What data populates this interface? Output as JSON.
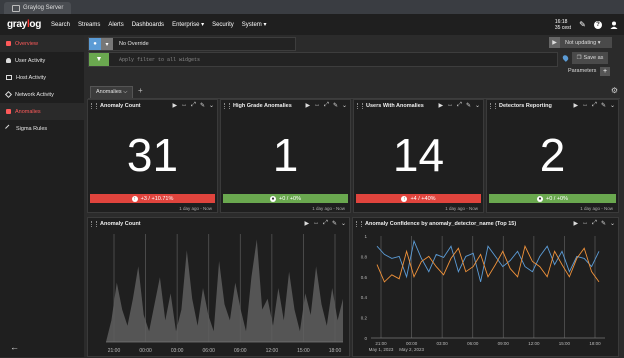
{
  "browser": {
    "tab_title": "Graylog Server"
  },
  "nav": {
    "logo": "graylog",
    "items": [
      "Search",
      "Streams",
      "Alerts",
      "Dashboards",
      "Enterprise ▾",
      "Security",
      "System ▾"
    ],
    "clock": [
      "16:18",
      "35 cest"
    ],
    "icons": [
      "edit-icon",
      "help-icon",
      "user-icon"
    ]
  },
  "sidebar": {
    "items": [
      {
        "label": "Overview",
        "active": true
      },
      {
        "label": "User Activity"
      },
      {
        "label": "Host Activity"
      },
      {
        "label": "Network Activity"
      },
      {
        "label": "Anomalies"
      },
      {
        "label": "Sigma Rules"
      }
    ]
  },
  "query": {
    "override": "No Override",
    "not_updating": "Not updating ▾",
    "filter_placeholder": "Apply filter to all widgets",
    "save_as": "Save as",
    "parameters": "Parameters"
  },
  "page_tabs": {
    "active": "Anomalies ⌵",
    "add": "+"
  },
  "widgets": [
    {
      "title": "Anomaly Count",
      "value": "31",
      "trend": "+3 / +10.71%",
      "trend_color": "red",
      "time": "1 day ago - Now"
    },
    {
      "title": "High Grade Anomalies",
      "value": "1",
      "trend": "+0 / +0%",
      "trend_color": "green",
      "time": "1 day ago - Now"
    },
    {
      "title": "Users With Anomalies",
      "value": "14",
      "trend": "+4 / +40%",
      "trend_color": "red",
      "time": "1 day ago - Now"
    },
    {
      "title": "Detectors Reporting",
      "value": "2",
      "trend": "+0 / +0%",
      "trend_color": "green",
      "time": "1 day ago - Now"
    }
  ],
  "chart_panels": {
    "left_title": "Anomaly Count",
    "right_title": "Anomaly Confidence by anomaly_detector_name (Top 15)"
  },
  "chart_data": [
    {
      "type": "area",
      "title": "Anomaly Count",
      "x_ticks": [
        "21:00",
        "00:00",
        "03:00",
        "06:00",
        "09:00",
        "12:00",
        "15:00",
        "18:00"
      ],
      "ylim": [
        0,
        1
      ],
      "values": [
        0,
        0.2,
        0.55,
        0.3,
        0.15,
        0.4,
        0.7,
        0.25,
        0.1,
        0.35,
        0.6,
        0.2,
        0.45,
        0.1,
        0.3,
        0.85,
        0.4,
        0.15,
        0.5,
        0.25,
        0.1,
        0.75,
        0.35,
        0.2,
        0.55,
        0.3,
        0.1,
        0.6,
        0.95,
        0.3,
        0.4,
        0.15,
        0.5,
        0.2,
        0.65,
        0.3,
        0.1,
        0.45,
        0.25,
        0.7,
        0.35,
        0.15,
        0.5,
        0.2,
        0.4
      ]
    },
    {
      "type": "line",
      "title": "Anomaly Confidence by anomaly_detector_name (Top 15)",
      "x_ticks": [
        "21:00",
        "00:00",
        "03:00",
        "06:00",
        "09:00",
        "12:00",
        "15:00",
        "18:00"
      ],
      "x_date_labels": [
        "May 1, 2023",
        "May 2, 2023"
      ],
      "y_ticks": [
        "0",
        "0.2",
        "0.4",
        "0.6",
        "0.8",
        "1"
      ],
      "ylim": [
        0,
        1
      ],
      "series": [
        {
          "color": "#5b9bd5",
          "values": [
            0.9,
            0.82,
            0.78,
            0.8,
            0.6,
            0.95,
            0.78,
            0.65,
            0.82,
            0.79,
            0.9,
            0.65,
            0.8,
            0.83,
            0.55,
            0.9,
            0.8,
            0.7,
            0.76,
            0.85,
            0.7,
            0.65,
            0.8,
            0.9,
            0.72,
            0.85,
            0.65,
            0.8,
            0.78,
            0.7,
            0.85
          ]
        },
        {
          "color": "#f0923a",
          "values": [
            0.72,
            0.55,
            0.62,
            0.58,
            0.85,
            0.6,
            0.75,
            0.8,
            0.7,
            0.62,
            0.78,
            0.88,
            0.65,
            0.7,
            0.82,
            0.6,
            0.72,
            0.85,
            0.68,
            0.6,
            0.9,
            0.75,
            0.7,
            0.6,
            0.85,
            0.72,
            0.6,
            0.78,
            0.88,
            0.65,
            0.55
          ]
        }
      ]
    }
  ]
}
